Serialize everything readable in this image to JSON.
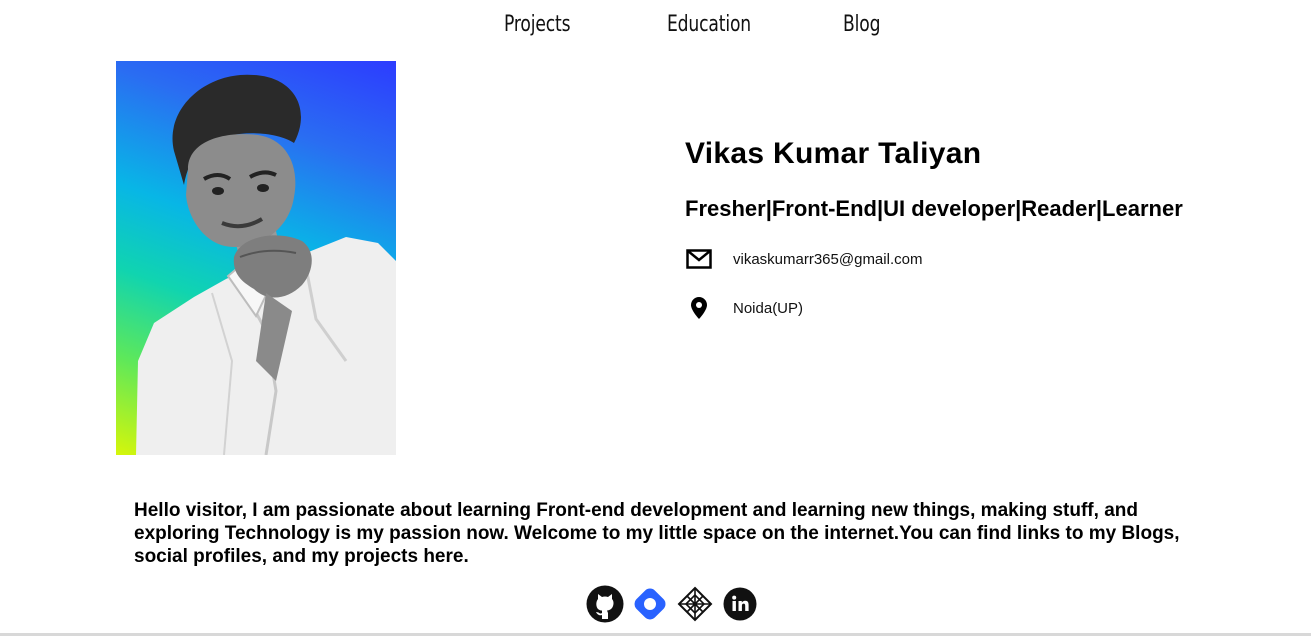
{
  "nav": {
    "items": [
      {
        "label": "Projects"
      },
      {
        "label": "Education"
      },
      {
        "label": "Blog"
      }
    ]
  },
  "profile": {
    "name": "Vikas Kumar Taliyan",
    "tagline": "Fresher|Front-End|UI developer|Reader|Learner",
    "email": "vikaskumarr365@gmail.com",
    "location": "Noida(UP)",
    "email_icon": "mail-icon",
    "location_icon": "location-pin-icon"
  },
  "about": {
    "text": "Hello visitor, I am passionate about learning Front-end development and learning new things, making stuff, and exploring Technology is my passion now. Welcome to my little space on the internet.You can find links to my Blogs, social profiles, and my projects here."
  },
  "social": [
    {
      "icon": "github-icon"
    },
    {
      "icon": "hashnode-icon"
    },
    {
      "icon": "codepen-icon"
    },
    {
      "icon": "linkedin-icon"
    }
  ],
  "colors": {
    "gradient_top": "#2d3cff",
    "gradient_mid": "#08b6e6",
    "gradient_bottom": "#d6f60a",
    "hashnode_blue": "#2962ff"
  }
}
